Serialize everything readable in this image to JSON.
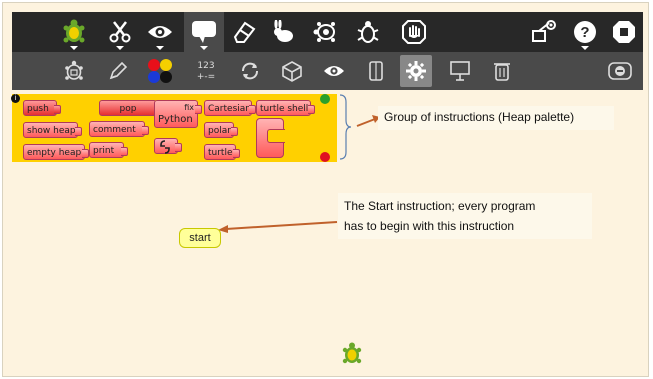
{
  "toolbar_main": {
    "buttons": [
      {
        "icon": "turtle-icon"
      },
      {
        "icon": "scissors-icon"
      },
      {
        "icon": "eye-icon"
      },
      {
        "icon": "speech-bubble-icon",
        "active": true
      },
      {
        "icon": "eraser-icon"
      },
      {
        "icon": "rabbit-icon"
      },
      {
        "icon": "turtle-slow-icon"
      },
      {
        "icon": "bug-icon"
      },
      {
        "icon": "stop-hand-icon"
      },
      {
        "icon": "share-icon"
      },
      {
        "icon": "help-icon"
      },
      {
        "icon": "power-icon"
      }
    ]
  },
  "toolbar_secondary": {
    "count_label": "123",
    "buttons": [
      {
        "icon": "turtle-outline-icon"
      },
      {
        "icon": "pen-icon"
      },
      {
        "icon": "color-palette-icon"
      },
      {
        "icon": "number-icon"
      },
      {
        "icon": "flow-icon"
      },
      {
        "icon": "box-icon"
      },
      {
        "icon": "eye-small-icon"
      },
      {
        "icon": "sensors-icon"
      },
      {
        "icon": "gear-icon",
        "active": true
      },
      {
        "icon": "presentation-icon"
      },
      {
        "icon": "trash-icon"
      },
      {
        "icon": "collapse-icon"
      }
    ]
  },
  "palette": {
    "blocks": {
      "push": "push",
      "show_heap": "show heap",
      "empty_heap": "empty heap",
      "pop": "pop",
      "comment": "comment",
      "print": "print",
      "fix": "fix",
      "python": "Python",
      "cartesian": "Cartesian",
      "polar": "polar",
      "turtle": "turtle",
      "turtle_shell": "turtle shell"
    }
  },
  "annotations": {
    "heap_palette": "Group of instructions (Heap palette)",
    "start_line1": "The Start instruction; every program",
    "start_line2": "has to begin with this instruction"
  },
  "canvas": {
    "start_label": "start"
  },
  "colors": {
    "toolbar": "#282828",
    "toolbar_secondary": "#4a4a4a",
    "palette": "#ffd000",
    "canvas": "#fdf3df",
    "arrow": "#c0612b"
  }
}
